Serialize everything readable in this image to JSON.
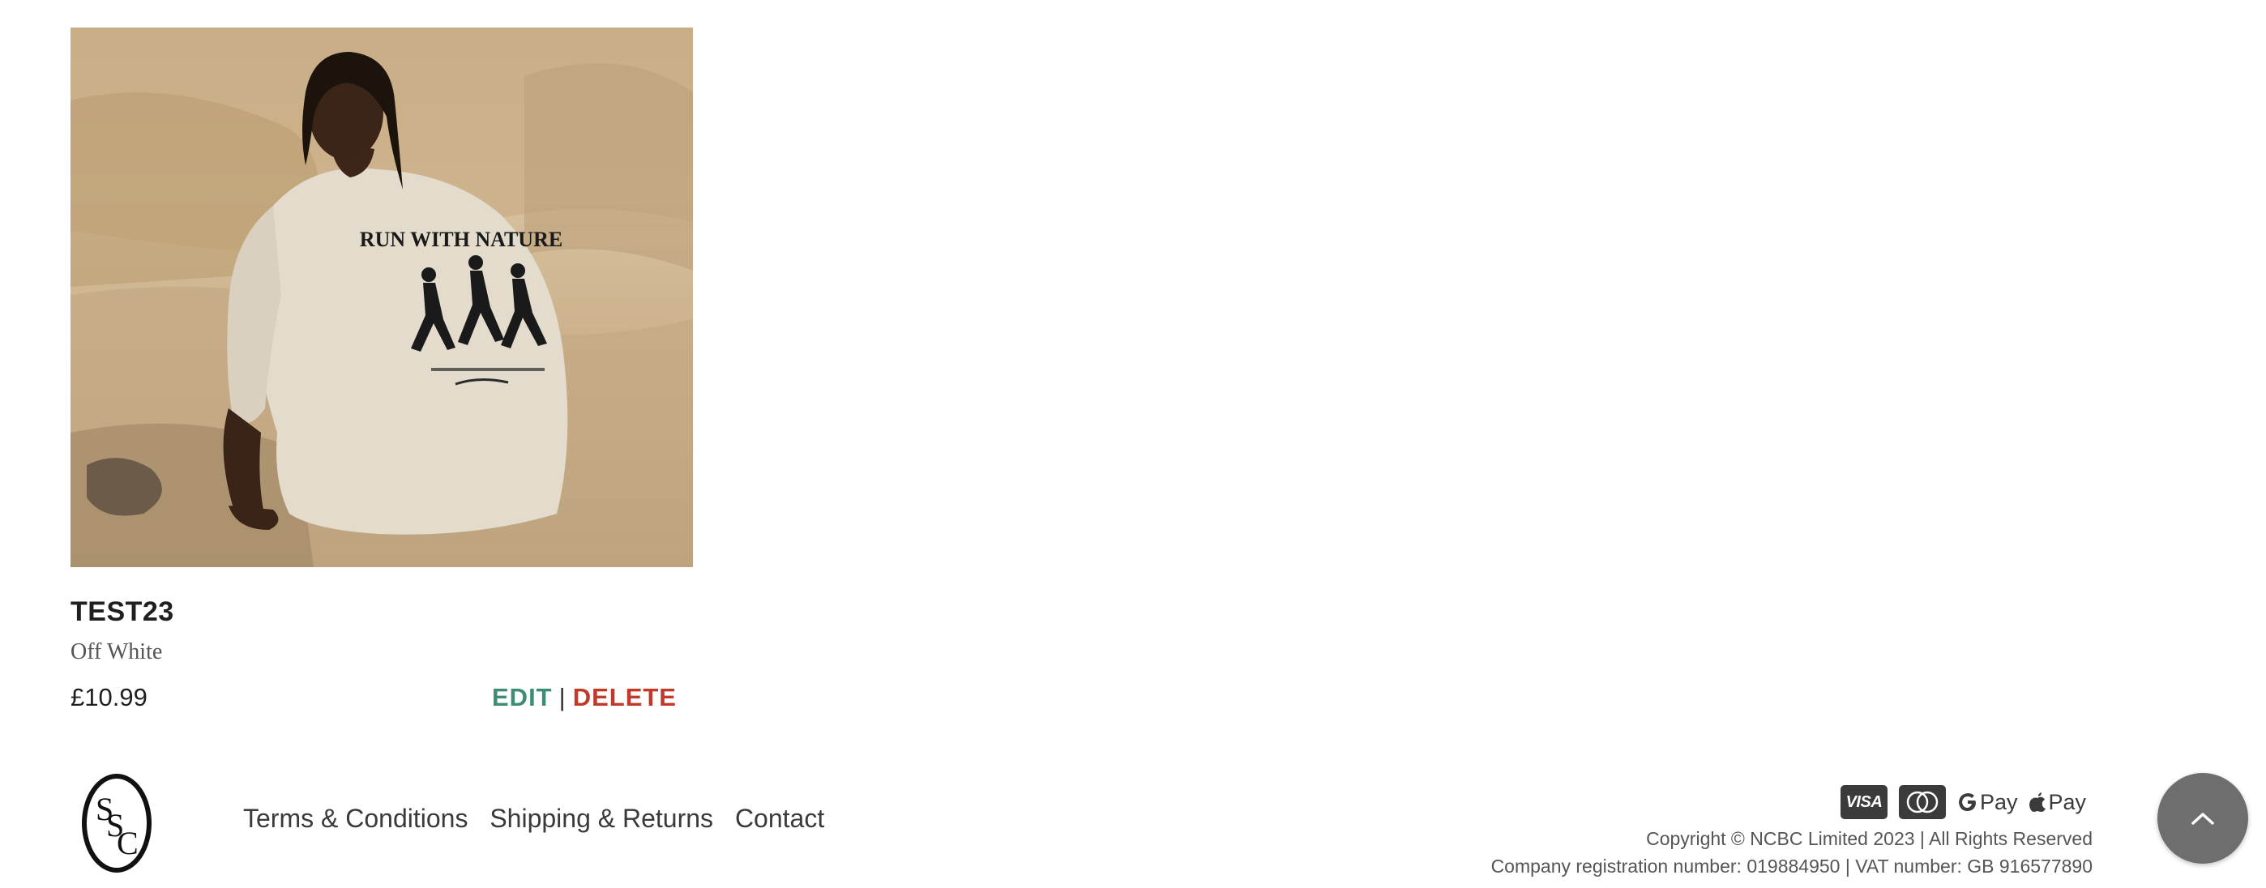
{
  "product": {
    "name": "TEST23",
    "color": "Off White",
    "price": "£10.99",
    "image_alt": "model-wearing-tshirt-photo",
    "shirt_print_heading": "RUN WITH NATURE",
    "edit_label": "EDIT",
    "separator": "|",
    "delete_label": "DELETE"
  },
  "footer": {
    "logo_alt": "ssc-logo",
    "links": {
      "terms": "Terms & Conditions",
      "shipping": "Shipping & Returns",
      "contact": "Contact"
    },
    "payments": {
      "visa": "VISA",
      "google_pay": "Pay",
      "apple_pay": "Pay"
    },
    "copyright": "Copyright © NCBC Limited 2023 | All Rights Reserved",
    "registration": "Company registration number: 019884950 | VAT number: GB 916577890"
  },
  "icons": {
    "back_to_top": "chevron-up-icon"
  },
  "colors": {
    "edit": "#3f8c74",
    "delete": "#c0392b",
    "back_to_top_bg": "#6e6e6e",
    "payment_icons": "#3b3b3b"
  }
}
